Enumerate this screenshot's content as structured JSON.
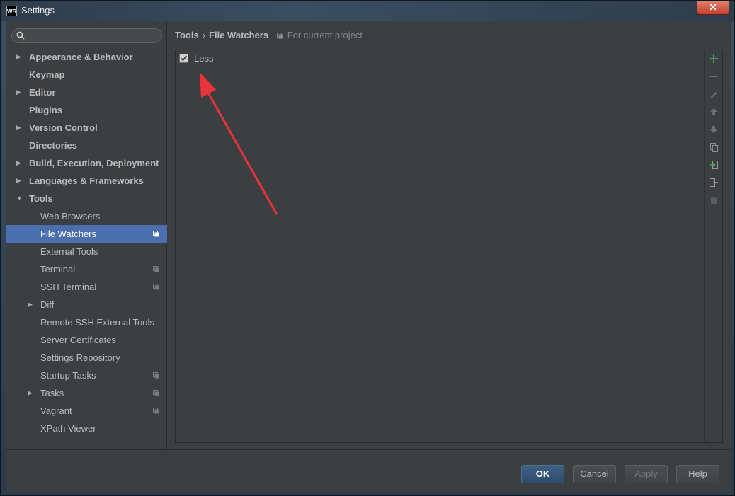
{
  "window": {
    "title": "Settings",
    "app_icon": "WS",
    "close_glyph": "✕"
  },
  "search": {
    "placeholder": ""
  },
  "tree": [
    {
      "label": "Appearance & Behavior",
      "level": 0,
      "expandable": true,
      "expanded": false
    },
    {
      "label": "Keymap",
      "level": 0,
      "expandable": false
    },
    {
      "label": "Editor",
      "level": 0,
      "expandable": true,
      "expanded": false
    },
    {
      "label": "Plugins",
      "level": 0,
      "expandable": false
    },
    {
      "label": "Version Control",
      "level": 0,
      "expandable": true,
      "expanded": false
    },
    {
      "label": "Directories",
      "level": 0,
      "expandable": false
    },
    {
      "label": "Build, Execution, Deployment",
      "level": 0,
      "expandable": true,
      "expanded": false
    },
    {
      "label": "Languages & Frameworks",
      "level": 0,
      "expandable": true,
      "expanded": false
    },
    {
      "label": "Tools",
      "level": 0,
      "expandable": true,
      "expanded": true
    },
    {
      "label": "Web Browsers",
      "level": 1,
      "expandable": false
    },
    {
      "label": "File Watchers",
      "level": 1,
      "expandable": false,
      "selected": true,
      "project_icon": true
    },
    {
      "label": "External Tools",
      "level": 1,
      "expandable": false
    },
    {
      "label": "Terminal",
      "level": 1,
      "expandable": false,
      "project_icon": true
    },
    {
      "label": "SSH Terminal",
      "level": 1,
      "expandable": false,
      "project_icon": true
    },
    {
      "label": "Diff",
      "level": 1,
      "expandable": true,
      "expanded": false
    },
    {
      "label": "Remote SSH External Tools",
      "level": 1,
      "expandable": false
    },
    {
      "label": "Server Certificates",
      "level": 1,
      "expandable": false
    },
    {
      "label": "Settings Repository",
      "level": 1,
      "expandable": false
    },
    {
      "label": "Startup Tasks",
      "level": 1,
      "expandable": false,
      "project_icon": true
    },
    {
      "label": "Tasks",
      "level": 1,
      "expandable": true,
      "expanded": false,
      "project_icon": true
    },
    {
      "label": "Vagrant",
      "level": 1,
      "expandable": false,
      "project_icon": true
    },
    {
      "label": "XPath Viewer",
      "level": 1,
      "expandable": false
    }
  ],
  "header": {
    "crumb_parent": "Tools",
    "separator": "›",
    "crumb_current": "File Watchers",
    "scope": "For current project"
  },
  "watchers": [
    {
      "label": "Less",
      "checked": true
    }
  ],
  "toolbar": [
    {
      "name": "add-icon",
      "color": "#499c54",
      "enabled": true
    },
    {
      "name": "remove-icon",
      "color": "#6e6e6e",
      "enabled": false
    },
    {
      "name": "edit-icon",
      "color": "#6e6e6e",
      "enabled": false
    },
    {
      "name": "move-up-icon",
      "color": "#6e6e6e",
      "enabled": false
    },
    {
      "name": "move-down-icon",
      "color": "#6e6e6e",
      "enabled": false
    },
    {
      "name": "copy-icon",
      "color": "#8c8c8c",
      "enabled": false
    },
    {
      "name": "import-icon",
      "color": "#499c54",
      "enabled": true
    },
    {
      "name": "export-icon",
      "color": "#b36ab8",
      "enabled": false
    },
    {
      "name": "trash-icon",
      "color": "#5e5e5e",
      "enabled": false
    }
  ],
  "buttons": {
    "ok": "OK",
    "cancel": "Cancel",
    "apply": "Apply",
    "help": "Help"
  },
  "colors": {
    "selection": "#4b6eaf",
    "background": "#3c3f41",
    "annotation_arrow": "#e8333b"
  }
}
